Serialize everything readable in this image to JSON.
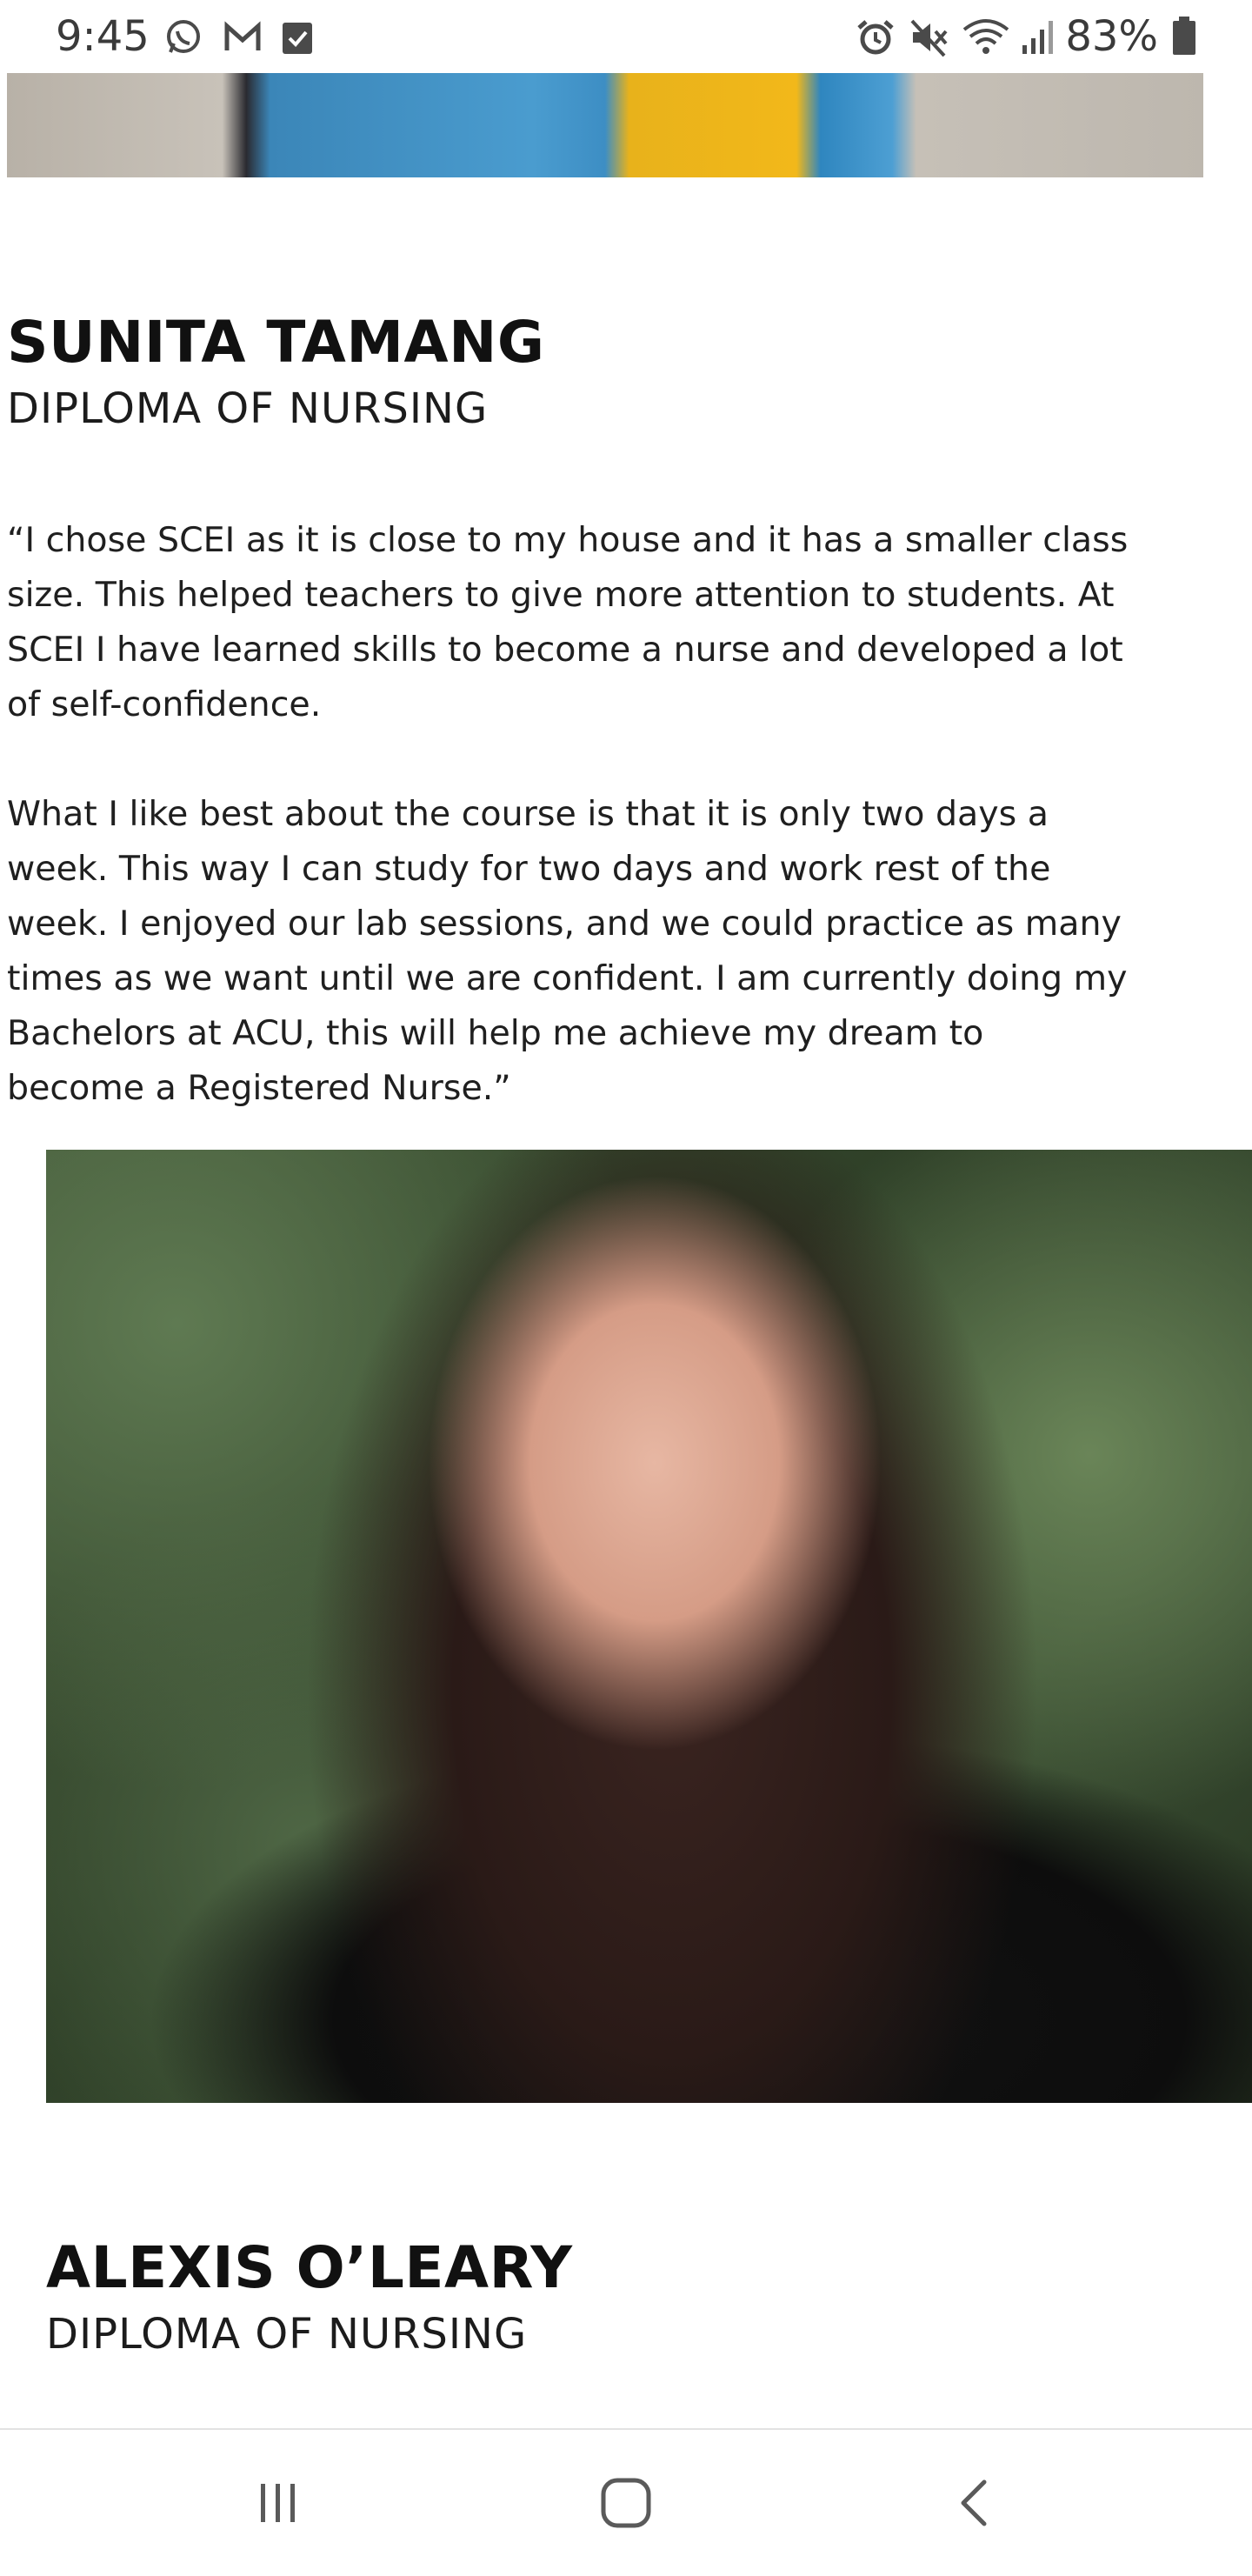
{
  "status_bar": {
    "time": "9:45",
    "battery_percent": "83%",
    "left_icons": [
      "whatsapp-icon",
      "gmail-icon",
      "task-check-icon"
    ],
    "right_icons": [
      "alarm-icon",
      "mute-icon",
      "wifi-icon",
      "signal-icon",
      "battery-icon"
    ]
  },
  "testimonials": [
    {
      "name": "SUNITA TAMANG",
      "program": "DIPLOMA OF NURSING",
      "quote": [
        "“I chose SCEI as it is close to my house and it has a smaller class size. This helped teachers to give more attention to students. At SCEI I have learned skills to become a nurse and developed a lot of self-confidence.",
        "What I like best about the course is that it is only two days a week. This way I can study for two days and work rest of the week. I enjoyed our lab sessions, and we could practice as many times as we want until we are confident. I am currently doing my Bachelors at ACU, this will help me achieve my dream to become a Registered Nurse.”"
      ]
    },
    {
      "name": "ALEXIS O’LEARY",
      "program": "DIPLOMA OF NURSING"
    }
  ],
  "nav_bar": {
    "icons": [
      "recent-apps-icon",
      "home-icon",
      "back-icon"
    ]
  }
}
